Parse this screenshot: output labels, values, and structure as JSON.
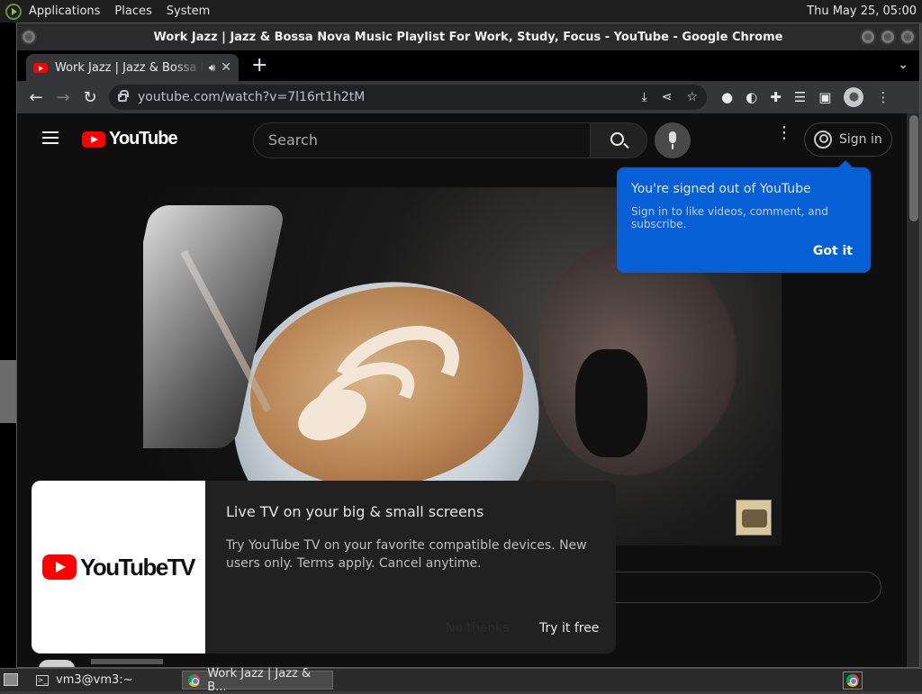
{
  "top_panel": {
    "menus": [
      "Applications",
      "Places",
      "System"
    ],
    "clock": "Thu May 25, 05:00"
  },
  "window": {
    "title": "Work Jazz | Jazz & Bossa Nova Music Playlist For Work, Study, Focus - YouTube - Google Chrome"
  },
  "tab": {
    "title": "Work Jazz | Jazz & Bossa Nova Music",
    "audio_icon": "speaker-icon",
    "close_glyph": "✕"
  },
  "newtab_glyph": "+",
  "tab_menu_glyph": "⌄",
  "toolbar": {
    "back": "←",
    "forward": "→",
    "reload": "↻",
    "url": "youtube.com/watch?v=7l16rt1h2tM"
  },
  "youtube": {
    "logo_text": "YouTube",
    "search_placeholder": "Search",
    "kebab": "⋮",
    "signin_label": "Sign in"
  },
  "tooltip": {
    "title": "You're signed out of YouTube",
    "body": "Sign in to like videos, comment, and subscribe.",
    "action": "Got it"
  },
  "promo": {
    "logo_text": "YouTubeTV",
    "title": "Live TV on your big & small screens",
    "body": "Try YouTube TV on your favorite compatible devices. New users only. Terms apply. Cancel anytime.",
    "dismiss": "No thanks",
    "cta": "Try it free"
  },
  "taskbar": {
    "terminal_label": "vm3@vm3:~",
    "chrome_label": "Work Jazz | Jazz & B..."
  },
  "colors": {
    "youtube_red": "#ff0000",
    "tooltip_blue": "#065fd4",
    "page_bg": "#0f0f0f"
  }
}
